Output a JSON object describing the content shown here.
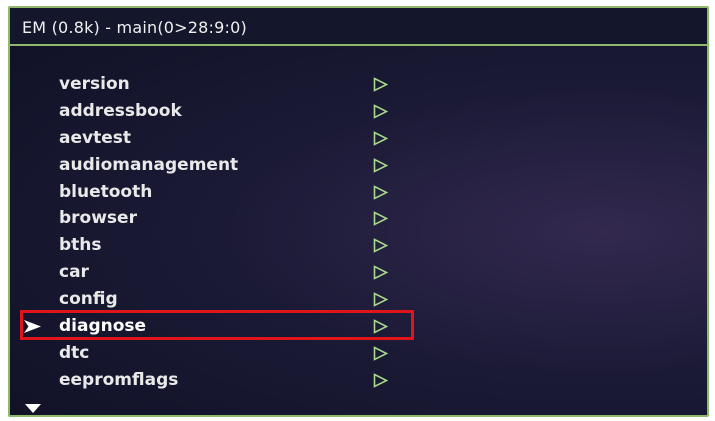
{
  "header": {
    "title": "EM (0.8k) - main(0>28:9:0)"
  },
  "menu": {
    "items": [
      {
        "label": "version"
      },
      {
        "label": "addressbook"
      },
      {
        "label": "aevtest"
      },
      {
        "label": "audiomanagement"
      },
      {
        "label": "bluetooth"
      },
      {
        "label": "browser"
      },
      {
        "label": "bths"
      },
      {
        "label": "car"
      },
      {
        "label": "config"
      },
      {
        "label": "diagnose"
      },
      {
        "label": "dtc"
      },
      {
        "label": "eepromflags"
      }
    ],
    "selected_label": "diagnose",
    "submenu_icon": "play-outline-icon",
    "selection_icon": "arrow-pointer-icon",
    "scroll_icon": "scroll-down-triangle-icon"
  },
  "colors": {
    "frame": "#8fb86a",
    "background": "#1b1a36",
    "text": "#e9e9e9",
    "accent_green": "#a7d98a",
    "highlight_border": "#e0141b"
  }
}
